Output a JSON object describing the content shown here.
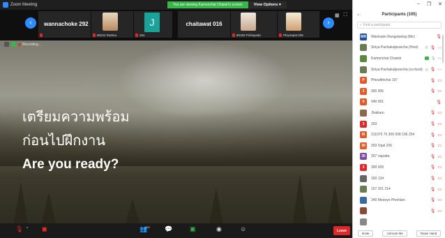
{
  "window": {
    "app_title": "Zoom Meeting"
  },
  "share_banner": {
    "message": "You are viewing Kamonchat Chaisiri's screen",
    "options_label": "View Options ▾"
  },
  "strip": {
    "tiles": [
      {
        "name": "wannachoke 292",
        "caption": ""
      },
      {
        "name": "",
        "caption": "60222 Ratima"
      },
      {
        "name": "",
        "caption": "264"
      },
      {
        "name": "J",
        "caption": ""
      },
      {
        "name": "chaitawat 016",
        "caption": ""
      },
      {
        "name": "",
        "caption": "60183 Pichayada"
      },
      {
        "name": "",
        "caption": "Ploynapat 035"
      }
    ]
  },
  "stage": {
    "recording_label": "Recording...",
    "slide": {
      "line1": "เตรียมความพร้อม",
      "line2": "ก่อนไปฝึกงาน",
      "line3": "Are you ready?"
    }
  },
  "toolbar": {
    "participants_count": "105",
    "leave_label": "Leave"
  },
  "panel": {
    "title": "Participants (105)",
    "search_placeholder": "Find a participant",
    "participants": [
      {
        "initials": "WR",
        "avatar_color": "#1e4fa0",
        "name": "Wanisarin Rangsiwong (Me)",
        "status": "mic-muted"
      },
      {
        "initials": "",
        "avatar_color": "#6a7a55",
        "name": "Siriya Pachakulpreecha (Host)",
        "status": "share-mic-cam"
      },
      {
        "initials": "",
        "avatar_color": "#5a8a3a",
        "name": "Kamonchat Chaisiri",
        "status": "sharing"
      },
      {
        "initials": "",
        "avatar_color": "#6a7a55",
        "name": "Siriya Pachakulpreecha (co-host)",
        "status": "share-mic-cam"
      },
      {
        "initials": "P",
        "avatar_color": "#e05a2a",
        "name": "Phisutthichai 197",
        "status": "mic-cam"
      },
      {
        "initials": "3",
        "avatar_color": "#e05a2a",
        "name": "300 005",
        "status": "mic-cam"
      },
      {
        "initials": "0",
        "avatar_color": "#e05a2a",
        "name": "040 001",
        "status": "mic"
      },
      {
        "initials": "",
        "avatar_color": "#8a6a4a",
        "name": "Jhaikarn",
        "status": "mic-cam"
      },
      {
        "initials": "3",
        "avatar_color": "#e02828",
        "name": "303",
        "status": "mic-cam"
      },
      {
        "initials": "M",
        "avatar_color": "#e05a2a",
        "name": "311070 76 306 008 106 254",
        "status": "mic-cam"
      },
      {
        "initials": "30",
        "avatar_color": "#e05a2a",
        "name": "303 Opal 206",
        "status": "mic-cam"
      },
      {
        "initials": "30",
        "avatar_color": "#7a4aa0",
        "name": "307 napatta",
        "status": "mic-cam"
      },
      {
        "initials": "3",
        "avatar_color": "#e02828",
        "name": "300 009",
        "status": "mic-cam"
      },
      {
        "initials": "",
        "avatar_color": "#666666",
        "name": "150 134",
        "status": "mic-cam"
      },
      {
        "initials": "",
        "avatar_color": "#6a7a55",
        "name": "157 201 214",
        "status": "mic-cam"
      },
      {
        "initials": "",
        "avatar_color": "#3a6aa0",
        "name": "240 Mooeye Phonlam",
        "status": "mic-cam"
      },
      {
        "initials": "",
        "avatar_color": "#8a4a3a",
        "name": "",
        "status": "mic-cam"
      },
      {
        "initials": "",
        "avatar_color": "#888888",
        "name": "",
        "status": ""
      }
    ],
    "footer": {
      "invite": "Invite",
      "unmute_me": "Unmute Me",
      "raise_hand": "Raise Hand"
    }
  },
  "colors": {
    "accent": "#2d8cff",
    "leave": "#e02828",
    "share_green": "#39b54a"
  }
}
